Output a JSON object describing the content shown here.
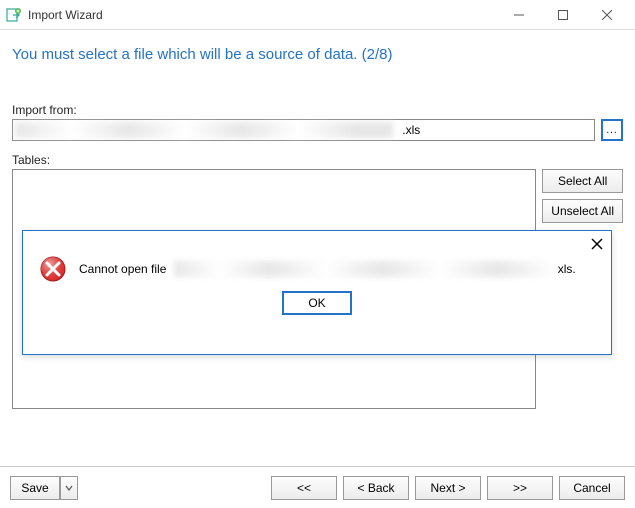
{
  "window": {
    "title": "Import Wizard"
  },
  "heading": "You must select a file which will be a source of data. (2/8)",
  "labels": {
    "import_from": "Import from:",
    "tables": "Tables:"
  },
  "import": {
    "visible_suffix": ".xls",
    "browse_label": "..."
  },
  "buttons": {
    "select_all": "Select All",
    "unselect_all": "Unselect All",
    "save": "Save",
    "first": "<<",
    "back": "< Back",
    "next": "Next >",
    "last": ">>",
    "cancel": "Cancel"
  },
  "dialog": {
    "message_prefix": "Cannot open file ",
    "message_suffix": "xls.",
    "ok": "OK"
  }
}
